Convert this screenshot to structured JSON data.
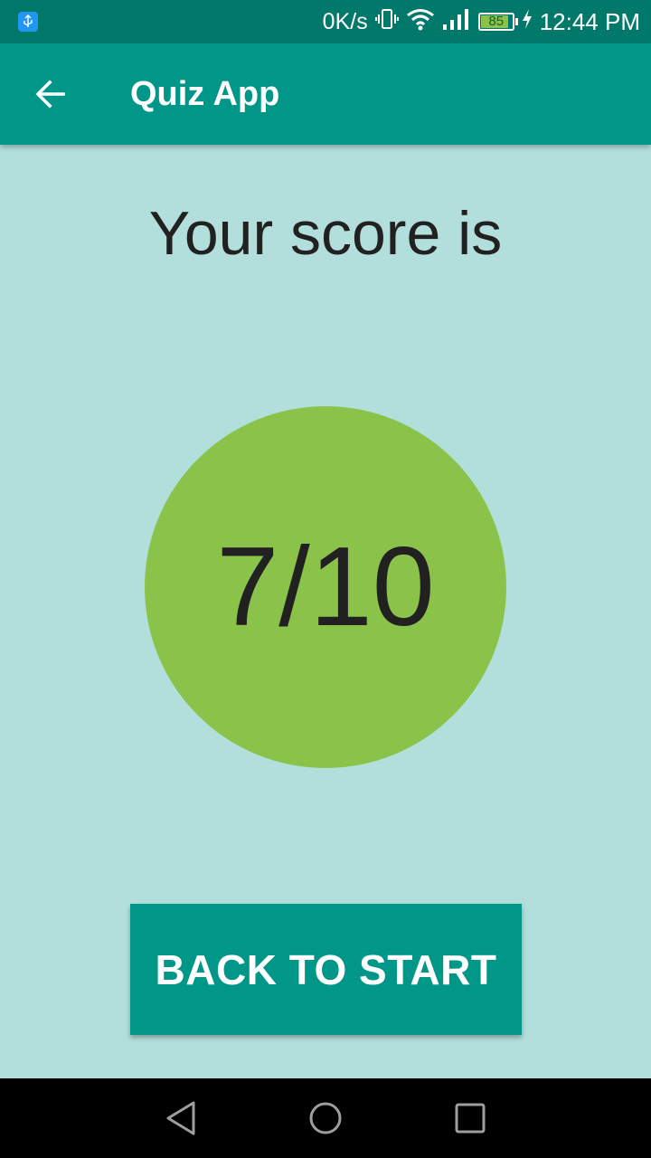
{
  "status_bar": {
    "net_speed": "0K/s",
    "battery_level": "85",
    "time": "12:44 PM",
    "icons": [
      "usb-icon",
      "vibrate-icon",
      "wifi-icon",
      "signal-icon",
      "battery-icon",
      "charging-icon"
    ]
  },
  "app_bar": {
    "title": "Quiz App",
    "back_icon": "arrow-back-icon"
  },
  "main": {
    "heading": "Your score is",
    "score": "7/10",
    "button_label": "BACK TO START"
  },
  "nav_bar": {
    "icons": [
      "back-triangle-icon",
      "home-circle-icon",
      "recents-square-icon"
    ]
  },
  "colors": {
    "status_bar": "#00796b",
    "app_bar": "#009688",
    "background": "#b2dfdb",
    "score_circle": "#8bc34a",
    "button": "#009688"
  }
}
